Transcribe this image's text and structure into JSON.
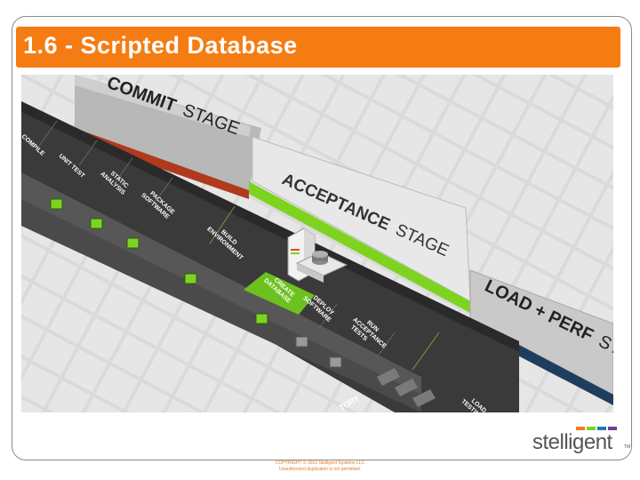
{
  "slide": {
    "title": "1.6 - Scripted Database"
  },
  "stages": {
    "commit_word1": "COMMIT",
    "commit_word2": "STAGE",
    "acceptance_word1": "ACCEPTANCE",
    "acceptance_word2": "STAGE",
    "load_word1": "LOAD + PERF",
    "load_word2": "STA"
  },
  "steps": {
    "compile": "COMPILE",
    "unit_test": "UNIT TEST",
    "static_analysis_1": "STATIC",
    "static_analysis_2": "ANALYSIS",
    "package_1": "PACKAGE",
    "package_2": "SOFTWARE",
    "build_1": "BUILD",
    "build_2": "ENVIRONMENT",
    "create_1": "CREATE",
    "create_2": "DATABASE",
    "deploy_1": "DEPLOY",
    "deploy_2": "SOFTWARE",
    "run_1": "RUN",
    "run_2": "ACCEPTANCE",
    "run_3": "TESTS",
    "load_1": "LOAD",
    "load_2": "TESTING",
    "story": "TORY"
  },
  "colors": {
    "orange": "#f57c12",
    "green": "#7ed321",
    "commit_red": "#b03a1e",
    "load_blue": "#1f3e5e"
  },
  "brand": {
    "name": "stelligent",
    "tm": "TM"
  },
  "footer": {
    "copyright_line1": "COPYRIGHT © 2012 Stelligent Systems LLC",
    "copyright_line2": "Unauthorized duplication is not permitted."
  }
}
